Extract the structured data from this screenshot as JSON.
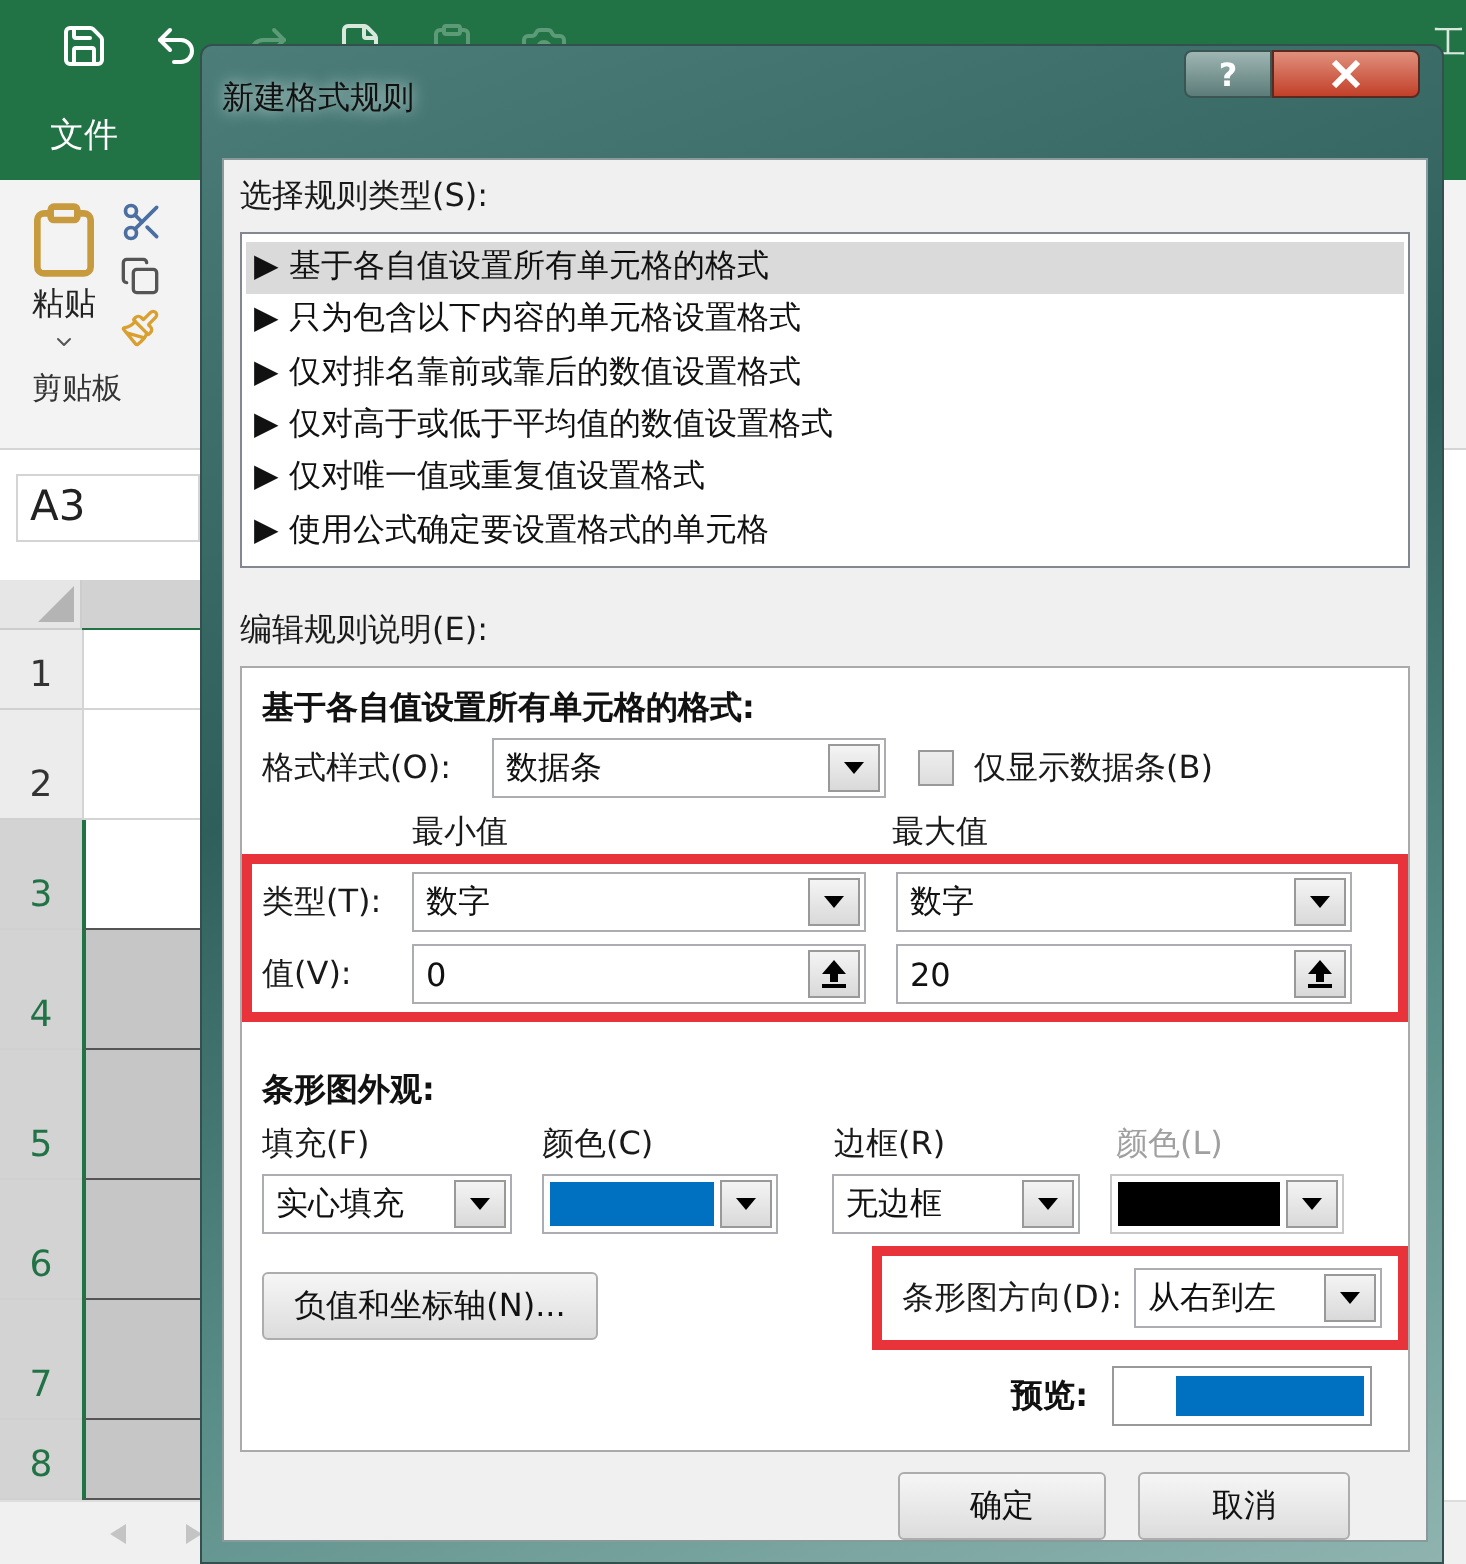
{
  "excel": {
    "title_fragment": "工",
    "file_tab": "文件",
    "paste_label": "粘贴",
    "clipboard_group": "剪贴板",
    "name_box": "A3",
    "rows": [
      {
        "label": "1",
        "selected": false,
        "active": false
      },
      {
        "label": "2",
        "selected": false,
        "active": false
      },
      {
        "label": "3",
        "selected": true,
        "active": true
      },
      {
        "label": "4",
        "selected": true,
        "active": false
      },
      {
        "label": "5",
        "selected": true,
        "active": false
      },
      {
        "label": "6",
        "selected": true,
        "active": false
      },
      {
        "label": "7",
        "selected": true,
        "active": false
      },
      {
        "label": "8",
        "selected": true,
        "active": false
      }
    ]
  },
  "dialog": {
    "title": "新建格式规则",
    "help": "?",
    "rule_type_label": "选择规则类型(S):",
    "rule_types": [
      {
        "label": "▶ 基于各自值设置所有单元格的格式",
        "selected": true
      },
      {
        "label": "▶ 只为包含以下内容的单元格设置格式",
        "selected": false
      },
      {
        "label": "▶ 仅对排名靠前或靠后的数值设置格式",
        "selected": false
      },
      {
        "label": "▶ 仅对高于或低于平均值的数值设置格式",
        "selected": false
      },
      {
        "label": "▶ 仅对唯一值或重复值设置格式",
        "selected": false
      },
      {
        "label": "▶ 使用公式确定要设置格式的单元格",
        "selected": false
      }
    ],
    "edit_label": "编辑规则说明(E):",
    "heading": "基于各自值设置所有单元格的格式:",
    "format_style": {
      "label": "格式样式(O):",
      "value": "数据条"
    },
    "bar_only": {
      "label": "仅显示数据条(B)",
      "checked": false
    },
    "min_header": "最小值",
    "max_header": "最大值",
    "type_row": {
      "label": "类型(T):",
      "min": "数字",
      "max": "数字"
    },
    "value_row": {
      "label": "值(V):",
      "min": "0",
      "max": "20"
    },
    "appearance_heading": "条形图外观:",
    "fill": {
      "label": "填充(F)",
      "value": "实心填充"
    },
    "fill_color": {
      "label": "颜色(C)",
      "color": "#0070c0"
    },
    "border": {
      "label": "边框(R)",
      "value": "无边框"
    },
    "border_color": {
      "label": "颜色(L)",
      "color": "#000000",
      "disabled": true
    },
    "negative_button": "负值和坐标轴(N)...",
    "direction": {
      "label": "条形图方向(D):",
      "value": "从右到左"
    },
    "preview": {
      "label": "预览:",
      "level": 0.77
    },
    "ok": "确定",
    "cancel": "取消"
  }
}
